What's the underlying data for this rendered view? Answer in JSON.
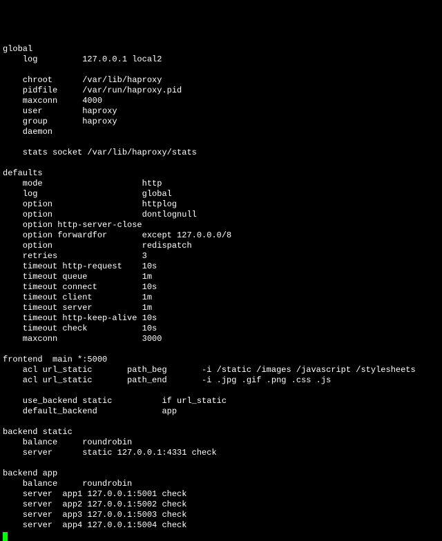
{
  "config_text": "global\n    log         127.0.0.1 local2\n\n    chroot      /var/lib/haproxy\n    pidfile     /var/run/haproxy.pid\n    maxconn     4000\n    user        haproxy\n    group       haproxy\n    daemon\n\n    stats socket /var/lib/haproxy/stats\n\ndefaults\n    mode                    http\n    log                     global\n    option                  httplog\n    option                  dontlognull\n    option http-server-close\n    option forwardfor       except 127.0.0.0/8\n    option                  redispatch\n    retries                 3\n    timeout http-request    10s\n    timeout queue           1m\n    timeout connect         10s\n    timeout client          1m\n    timeout server          1m\n    timeout http-keep-alive 10s\n    timeout check           10s\n    maxconn                 3000\n\nfrontend  main *:5000\n    acl url_static       path_beg       -i /static /images /javascript /stylesheets\n    acl url_static       path_end       -i .jpg .gif .png .css .js\n\n    use_backend static          if url_static\n    default_backend             app\n\nbackend static\n    balance     roundrobin\n    server      static 127.0.0.1:4331 check\n\nbackend app\n    balance     roundrobin\n    server  app1 127.0.0.1:5001 check\n    server  app2 127.0.0.1:5002 check\n    server  app3 127.0.0.1:5003 check\n    server  app4 127.0.0.1:5004 check"
}
